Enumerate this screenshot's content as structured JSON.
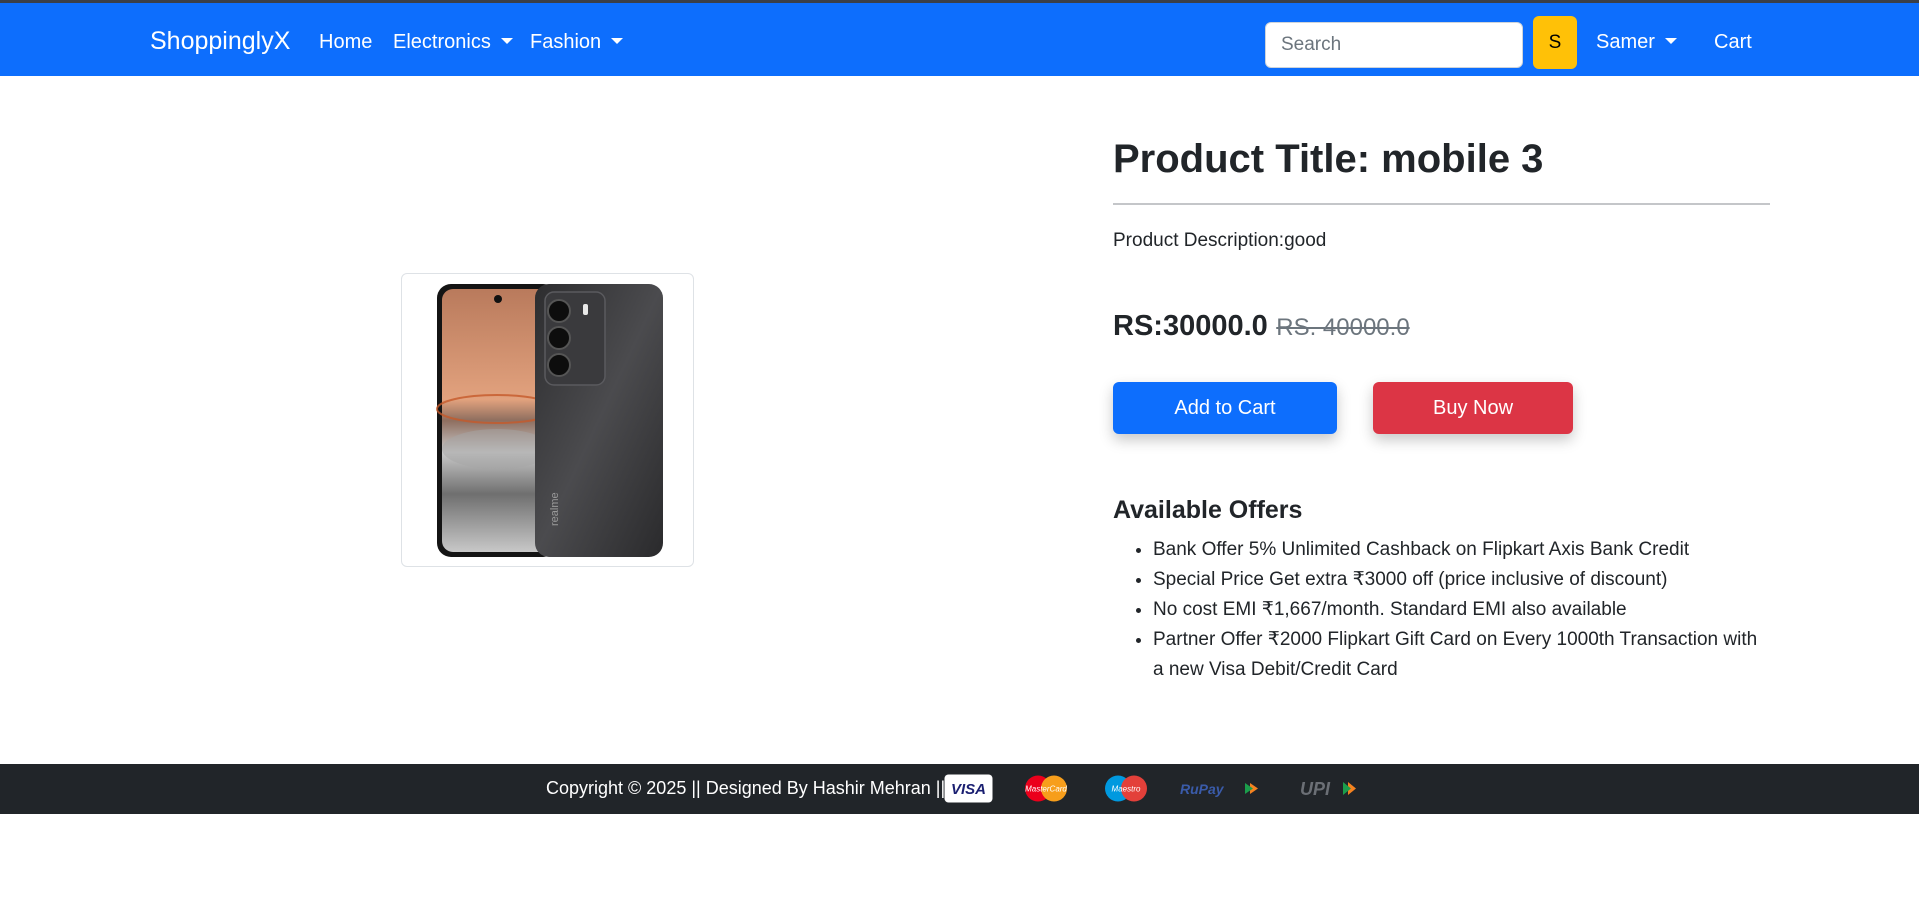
{
  "navbar": {
    "brand": "ShoppinglyX",
    "links": [
      "Home",
      "Electronics",
      "Fashion"
    ],
    "search_placeholder": "Search",
    "search_button": "S",
    "user": "Samer",
    "cart": "Cart",
    "color": "#0d6efd"
  },
  "product": {
    "title": "Product Title: mobile 3",
    "description": "Product Description:good",
    "price": "RS:30000.0",
    "old_price": "RS. 40000.0",
    "image_icon": "smartphone-image",
    "phone_brand": "realme"
  },
  "actions": {
    "add_to_cart": "Add to Cart",
    "buy_now": "Buy Now"
  },
  "offers": {
    "title": "Available Offers",
    "items": [
      "Bank Offer 5% Unlimited Cashback on Flipkart Axis Bank Credit",
      "Special Price Get extra ₹3000 off (price inclusive of discount)",
      "No cost EMI ₹1,667/month. Standard EMI also available",
      "Partner Offer ₹2000 Flipkart Gift Card on Every 1000th Transaction with a new Visa Debit/Credit Card"
    ]
  },
  "footer": {
    "copyright": "Copyright © 2025 || Designed By Hashir Mehran ||",
    "payment_logos": [
      "VISA",
      "MasterCard",
      "Maestro",
      "RuPay",
      "UPI"
    ]
  }
}
